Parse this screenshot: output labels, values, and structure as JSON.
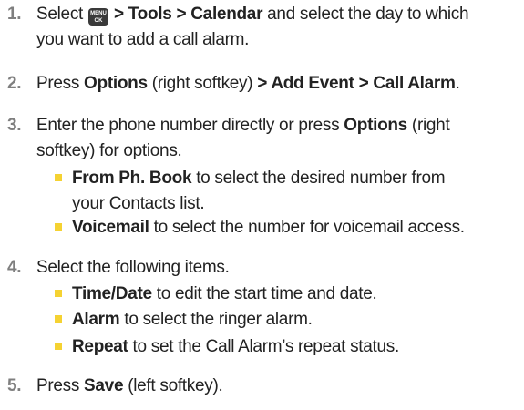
{
  "steps": [
    {
      "num": "1.",
      "pre": "Select ",
      "key_top": "MENU",
      "key_bottom": "OK",
      "path": " > Tools > Calendar",
      "rest": " and select the day to which",
      "line2": "you want to add a call alarm."
    },
    {
      "num": "2.",
      "pre": "Press ",
      "b1": "Options",
      "mid": " (right softkey) ",
      "b2": "> Add Event > Call Alarm",
      "end": "."
    },
    {
      "num": "3.",
      "pre": "Enter the phone number directly or press ",
      "b1": "Options",
      "mid": " (right",
      "line2": "softkey) for options.",
      "subs": [
        {
          "b": "From Ph. Book",
          "t": " to select the desired number from",
          "t2": "your Contacts list."
        },
        {
          "b": "Voicemail",
          "t": " to select the number for voicemail access."
        }
      ]
    },
    {
      "num": "4.",
      "pre": "Select the following items.",
      "subs": [
        {
          "b": "Time/Date",
          "t": " to edit the start time and date."
        },
        {
          "b": "Alarm",
          "t": " to select the ringer alarm."
        },
        {
          "b": "Repeat",
          "t": " to set the Call Alarm’s repeat status."
        }
      ]
    },
    {
      "num": "5.",
      "pre": "Press ",
      "b1": "Save",
      "mid": " (left softkey)."
    }
  ]
}
